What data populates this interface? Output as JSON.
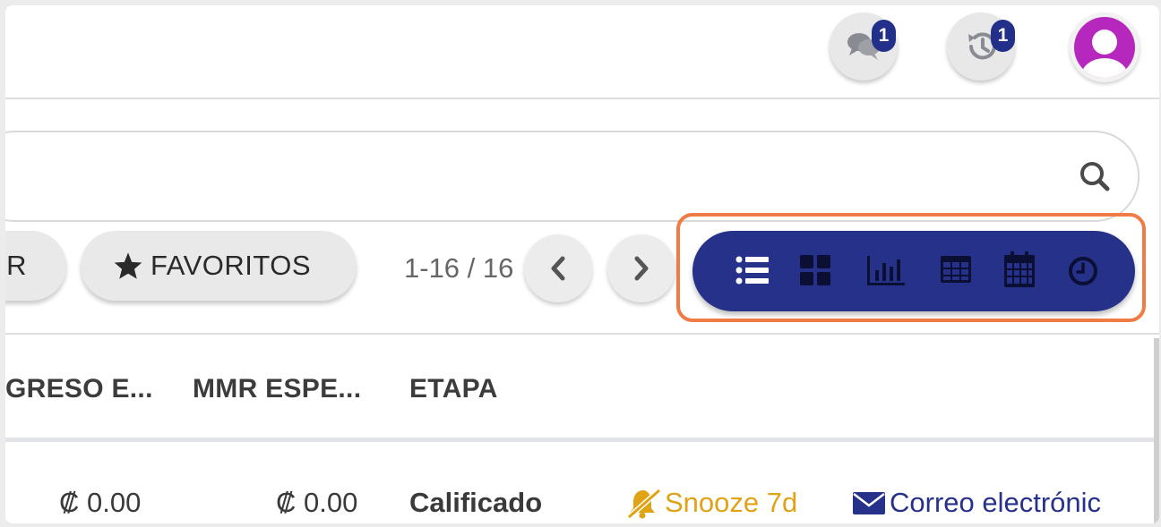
{
  "topbar": {
    "messages": {
      "icon": "chat-bubbles-icon",
      "badge": "1"
    },
    "activity": {
      "icon": "history-clock-icon",
      "badge": "1"
    },
    "avatar": {
      "icon": "user-avatar-icon",
      "color": "#b627bd"
    }
  },
  "search": {
    "icon": "search-icon"
  },
  "filters": {
    "partial_label": "R",
    "favorites_label": "FAVORITOS",
    "favorites_icon": "star-icon"
  },
  "pager": {
    "range": "1-16 / 16",
    "prev_icon": "chevron-left-icon",
    "next_icon": "chevron-right-icon"
  },
  "views": {
    "accent": "#26318a",
    "highlight": "#f07b45",
    "items": [
      {
        "icon": "list-view-icon",
        "active": true
      },
      {
        "icon": "kanban-view-icon"
      },
      {
        "icon": "graph-view-icon"
      },
      {
        "icon": "pivot-view-icon"
      },
      {
        "icon": "calendar-view-icon"
      },
      {
        "icon": "activity-view-icon"
      }
    ]
  },
  "table": {
    "headers": [
      "GRESO E...",
      "MMR ESPE...",
      "ETAPA"
    ],
    "rows": [
      {
        "ingreso": "₡ 0.00",
        "mmr": "₡ 0.00",
        "etapa": "Calificado",
        "snooze": "Snooze 7d",
        "email": "Correo electrónic"
      }
    ]
  },
  "colors": {
    "snooze": "#e0a316",
    "email": "#26318a"
  }
}
